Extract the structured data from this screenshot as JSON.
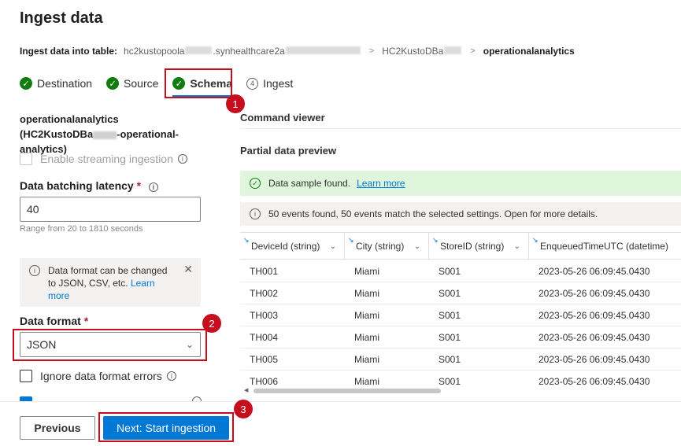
{
  "header": {
    "title": "Ingest data",
    "breadcrumb_label": "Ingest data into table:",
    "cluster_start": "hc2kustopoola",
    "cluster_mid": ".synhealthcare2a",
    "database_start": "HC2KustoDBa",
    "table": "operationalanalytics"
  },
  "tabs": [
    {
      "label": "Destination",
      "state": "done"
    },
    {
      "label": "Source",
      "state": "done"
    },
    {
      "label": "Schema",
      "state": "active"
    },
    {
      "label": "Ingest",
      "state": "pending",
      "number": "4"
    }
  ],
  "annotations": [
    "1",
    "2",
    "3"
  ],
  "left_panel": {
    "table_name_line1": "operationalanalytics",
    "table_name_line2_start": "(HC2KustoDBa",
    "table_name_line2_end": "-operational-",
    "table_name_line3": "analytics)",
    "streaming_label": "Enable streaming ingestion",
    "latency_label": "Data batching latency",
    "required_mark": "*",
    "latency_value": "40",
    "latency_hint": "Range from 20 to 1810 seconds",
    "info_text": "Data format can be changed to JSON, CSV, etc.",
    "info_link": "Learn more",
    "format_label": "Data format",
    "format_value": "JSON",
    "ignore_errors_label": "Ignore data format errors"
  },
  "right_panel": {
    "command_viewer": "Command viewer",
    "partial_preview": "Partial data preview",
    "success_text": "Data sample found.",
    "success_link": "Learn more",
    "info_text": "50 events found, 50 events match the selected settings. Open for more details."
  },
  "table": {
    "columns": [
      "DeviceId (string)",
      "City (string)",
      "StoreID (string)",
      "EnqueuedTimeUTC (datetime)"
    ],
    "rows": [
      [
        "TH001",
        "Miami",
        "S001",
        "2023-05-26 06:09:45.0430"
      ],
      [
        "TH002",
        "Miami",
        "S001",
        "2023-05-26 06:09:45.0430"
      ],
      [
        "TH003",
        "Miami",
        "S001",
        "2023-05-26 06:09:45.0430"
      ],
      [
        "TH004",
        "Miami",
        "S001",
        "2023-05-26 06:09:45.0430"
      ],
      [
        "TH005",
        "Miami",
        "S001",
        "2023-05-26 06:09:45.0430"
      ],
      [
        "TH006",
        "Miami",
        "S001",
        "2023-05-26 06:09:45.0430"
      ]
    ]
  },
  "footer": {
    "previous": "Previous",
    "next": "Next: Start ingestion"
  },
  "colors": {
    "accent": "#0078d4",
    "success": "#107c10",
    "highlight": "#c50f1f"
  },
  "icons": {
    "done": "check-circle-icon",
    "info": "info-icon",
    "close": "close-icon",
    "chevron": "chevron-down-icon"
  }
}
